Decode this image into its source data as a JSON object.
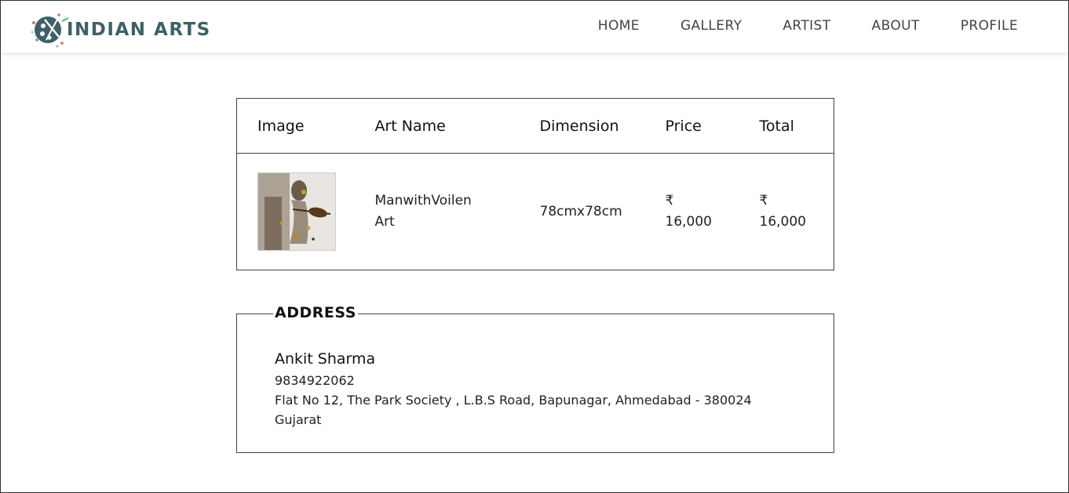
{
  "brand": {
    "name": "INDIAN ARTS",
    "text_color": "#3e6068"
  },
  "nav": {
    "items": [
      "HOME",
      "GALLERY",
      "ARTIST",
      "ABOUT",
      "PROFILE"
    ]
  },
  "cart": {
    "headers": [
      "Image",
      "Art Name",
      "Dimension",
      "Price",
      "Total"
    ],
    "rows": [
      {
        "image": "man-with-violin-painting",
        "art_name": "ManwithVoilen Art",
        "dimension": "78cmx78cm",
        "price_symbol": "₹",
        "price": "16,000",
        "total_symbol": "₹",
        "total": "16,000"
      }
    ]
  },
  "address": {
    "legend": "ADDRESS",
    "name": "Ankit Sharma",
    "phone": "9834922062",
    "line1": "Flat No 12, The Park Society , L.B.S Road, Bapunagar, Ahmedabad - 380024",
    "state": "Gujarat"
  }
}
